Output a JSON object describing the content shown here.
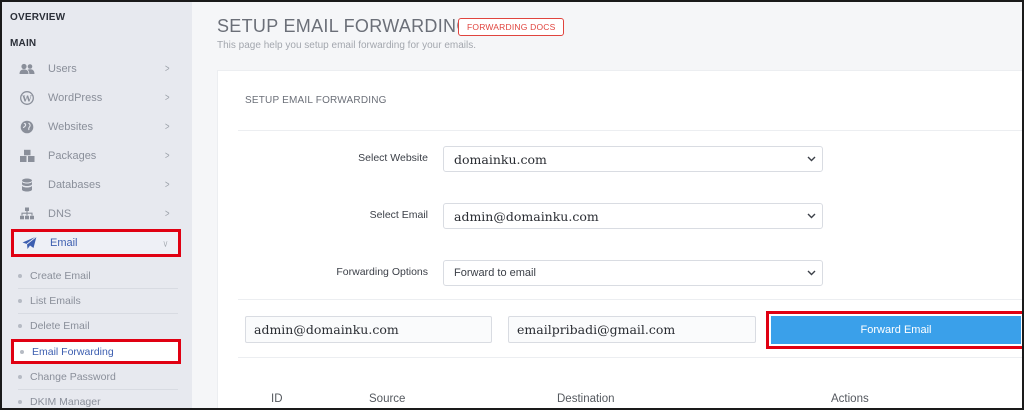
{
  "sidebar": {
    "overview_label": "OVERVIEW",
    "main_label": "MAIN",
    "items": [
      {
        "label": "Users",
        "icon": "users-icon"
      },
      {
        "label": "WordPress",
        "icon": "wordpress-icon"
      },
      {
        "label": "Websites",
        "icon": "globe-icon"
      },
      {
        "label": "Packages",
        "icon": "cubes-icon"
      },
      {
        "label": "Databases",
        "icon": "database-icon"
      },
      {
        "label": "DNS",
        "icon": "sitemap-icon"
      },
      {
        "label": "Email",
        "icon": "paper-plane-icon"
      }
    ],
    "email_sub": [
      {
        "label": "Create Email"
      },
      {
        "label": "List Emails"
      },
      {
        "label": "Delete Email"
      },
      {
        "label": "Email Forwarding"
      },
      {
        "label": "Change Password"
      },
      {
        "label": "DKIM Manager"
      }
    ],
    "active_color": "#3d5fb0",
    "highlight_color": "#e00012"
  },
  "header": {
    "title": "SETUP EMAIL FORWARDING -",
    "docs_badge": "FORWARDING DOCS",
    "subtitle": "This page help you setup email forwarding for your emails."
  },
  "panel": {
    "title": "SETUP EMAIL FORWARDING",
    "select_website_label": "Select Website",
    "select_website_value": "domainku.com",
    "select_email_label": "Select Email",
    "select_email_value": "admin@domainku.com",
    "forwarding_options_label": "Forwarding Options",
    "forwarding_options_value": "Forward to email",
    "source_value": "admin@domainku.com",
    "destination_value": "emailpribadi@gmail.com",
    "forward_button": "Forward Email",
    "button_color": "#3aa0ea"
  },
  "table": {
    "columns": [
      "ID",
      "Source",
      "Destination",
      "Actions"
    ]
  }
}
